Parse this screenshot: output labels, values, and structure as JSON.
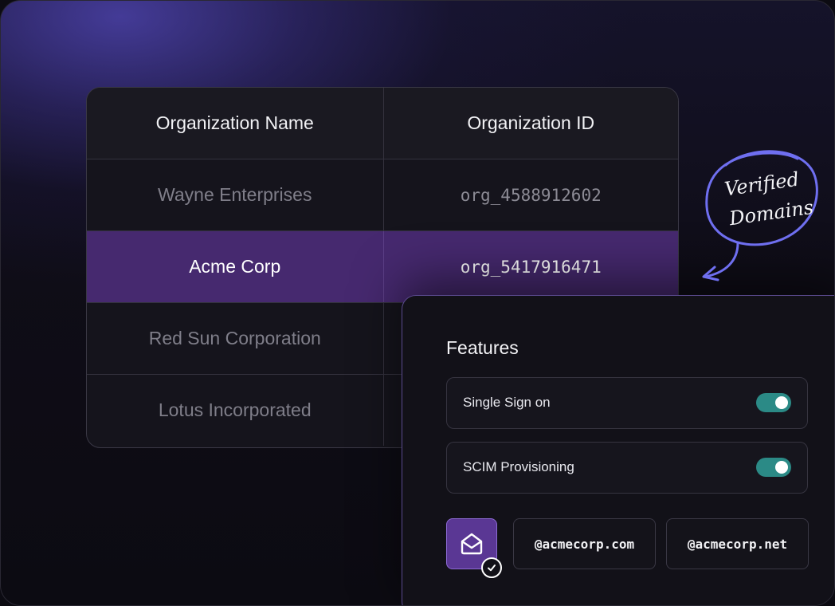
{
  "org_table": {
    "headers": {
      "name": "Organization Name",
      "id": "Organization ID"
    },
    "rows": [
      {
        "name": "Wayne Enterprises",
        "id": "org_4588912602",
        "selected": false
      },
      {
        "name": "Acme Corp",
        "id": "org_5417916471",
        "selected": true
      },
      {
        "name": "Red Sun Corporation",
        "id": "",
        "selected": false
      },
      {
        "name": "Lotus Incorporated",
        "id": "",
        "selected": false
      }
    ]
  },
  "features": {
    "title": "Features",
    "items": [
      {
        "label": "Single Sign on",
        "enabled": true
      },
      {
        "label": "SCIM Provisioning",
        "enabled": true
      }
    ],
    "domains": [
      "@acmecorp.com",
      "@acmecorp.net"
    ],
    "mail_icon": "mail-open-icon",
    "check_icon": "check-circle-icon"
  },
  "annotation": {
    "line1": "Verified",
    "line2": "Domains"
  },
  "colors": {
    "accent": "#46296f",
    "toggle_on": "#2b8a86",
    "annotation_stroke": "#6f6ff0",
    "background": "#0c0b12"
  }
}
